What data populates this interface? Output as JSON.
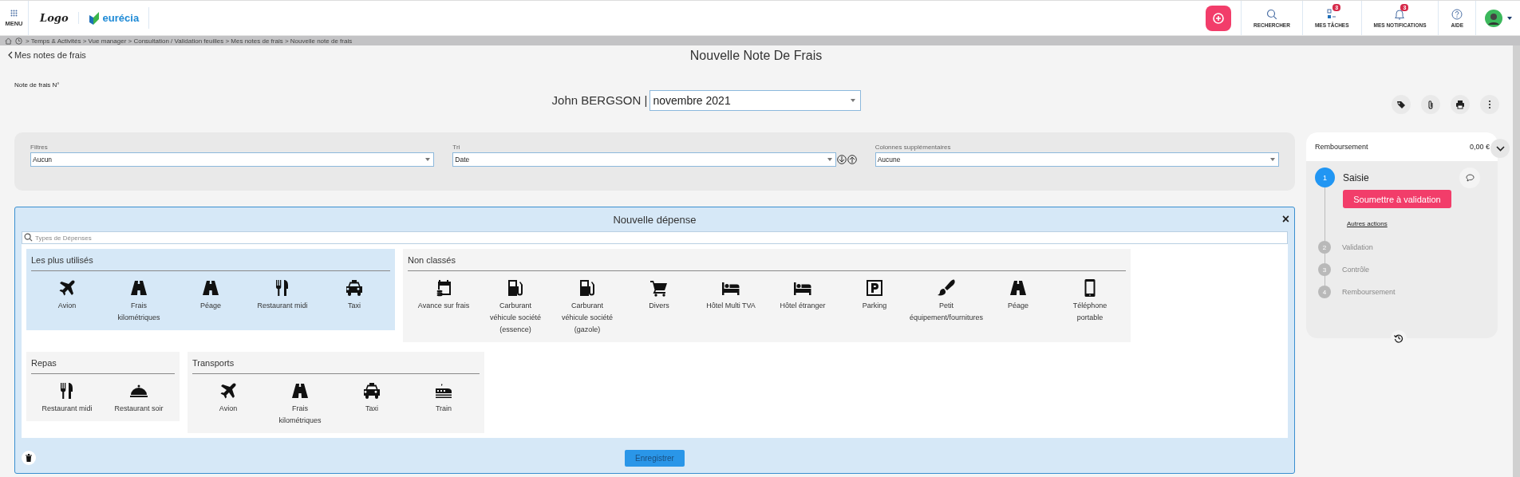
{
  "top_bar": {
    "menu_label": "MENU",
    "logo_text": "Logo",
    "brand": "eurécia",
    "actions": [
      {
        "kind": "search",
        "label": "RECHERCHER"
      },
      {
        "kind": "tasks",
        "label": "MES TÂCHES",
        "badge": "3"
      },
      {
        "kind": "bell",
        "label": "MES NOTIFICATIONS",
        "badge": "3"
      },
      {
        "kind": "help",
        "label": "AIDE"
      }
    ]
  },
  "breadcrumb": "> Temps & Activités > Vue manager > Consultation / Validation feuilles > Mes notes de frais > Nouvelle note de frais",
  "back_link": "Mes notes de frais",
  "page_title": "Nouvelle Note De Frais",
  "note_number_label": "Note de frais N°",
  "employee": "John BERGSON |",
  "period": "novembre 2021",
  "toolbar": [
    {
      "kind": "tag"
    },
    {
      "kind": "clip"
    },
    {
      "kind": "print"
    },
    {
      "kind": "more"
    }
  ],
  "filters": [
    {
      "label": "Filtres",
      "value": "Aucun",
      "sort_arrows": false
    },
    {
      "label": "Tri",
      "value": "Date",
      "sort_arrows": true
    },
    {
      "label": "Colonnes supplémentaires",
      "value": "Aucune",
      "sort_arrows": false
    }
  ],
  "workflow": {
    "title": "Remboursement",
    "amount": "0,00 €",
    "submit": "Soumettre à validation",
    "other_actions": "Autres actions",
    "steps": [
      {
        "number": "1",
        "label": "Saisie",
        "active": true
      },
      {
        "number": "2",
        "label": "Validation",
        "active": false
      },
      {
        "number": "3",
        "label": "Contrôle",
        "active": false
      },
      {
        "number": "4",
        "label": "Remboursement",
        "active": false
      }
    ]
  },
  "expense_panel": {
    "title": "Nouvelle dépense",
    "close": "×",
    "search": {
      "placeholder": "Types de Dépenses"
    },
    "save": "Enregistrer",
    "groups": [
      {
        "title": "Les plus utilisés",
        "selected": true,
        "items": [
          {
            "kind": "plane",
            "label": "Avion"
          },
          {
            "kind": "road",
            "label": "Frais kilométriques"
          },
          {
            "kind": "road",
            "label": "Péage"
          },
          {
            "kind": "cutlery",
            "label": "Restaurant midi"
          },
          {
            "kind": "taxi",
            "label": "Taxi"
          }
        ]
      },
      {
        "title": "Non classés",
        "selected": false,
        "items": [
          {
            "kind": "calendar",
            "label": "Avance sur frais"
          },
          {
            "kind": "fuel",
            "label": "Carburant véhicule société (essence)"
          },
          {
            "kind": "fuel",
            "label": "Carburant véhicule société (gazole)"
          },
          {
            "kind": "cart",
            "label": "Divers"
          },
          {
            "kind": "bed",
            "label": "Hôtel Multi TVA"
          },
          {
            "kind": "bed",
            "label": "Hôtel étranger"
          },
          {
            "kind": "parking",
            "label": "Parking"
          },
          {
            "kind": "brush",
            "label": "Petit équipement/fournitures"
          },
          {
            "kind": "road",
            "label": "Péage"
          },
          {
            "kind": "phone",
            "label": "Téléphone portable"
          }
        ]
      },
      {
        "title": "Repas",
        "selected": false,
        "items": [
          {
            "kind": "cutlery",
            "label": "Restaurant midi"
          },
          {
            "kind": "cloche",
            "label": "Restaurant soir"
          }
        ]
      },
      {
        "title": "Transports",
        "selected": false,
        "items": [
          {
            "kind": "plane",
            "label": "Avion"
          },
          {
            "kind": "road",
            "label": "Frais kilométriques"
          },
          {
            "kind": "taxi",
            "label": "Taxi"
          },
          {
            "kind": "train",
            "label": "Train"
          }
        ]
      }
    ]
  }
}
